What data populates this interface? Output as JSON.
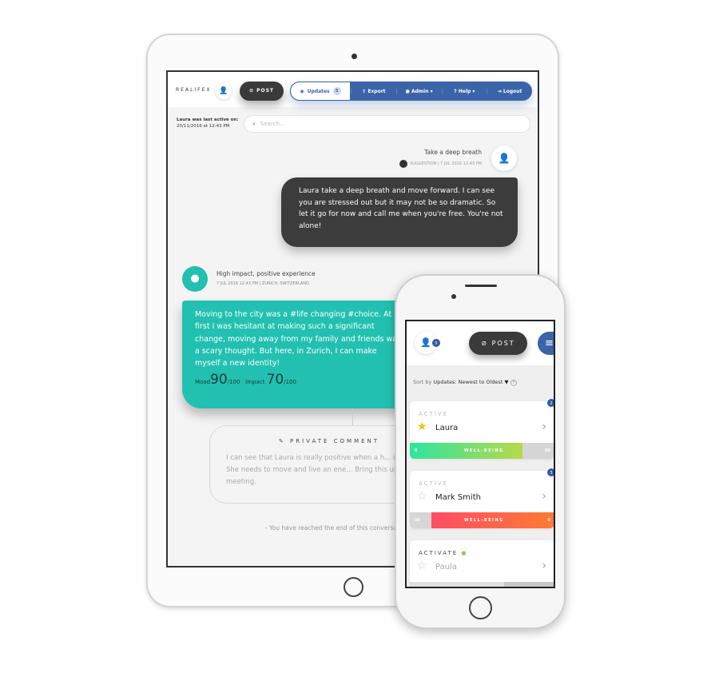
{
  "tablet": {
    "brand": "REALIFEX",
    "post_label": "POST",
    "nav": [
      {
        "label": "Updates",
        "badge": "5"
      },
      {
        "label": "Export"
      },
      {
        "label": "Admin"
      },
      {
        "label": "Help"
      },
      {
        "label": "Logout"
      }
    ],
    "last_active_label": "Laura was last active on:",
    "last_active_date": "20/11/2016 at 12:43 PM",
    "search_placeholder": "Search...",
    "suggestion": {
      "title": "Take a deep breath",
      "meta": "SUGGESTION | 7 JUL 2016 12:43 PM",
      "text": "Laura take a deep breath and move forward. I can see you are stressed out but it may not be so dramatic. So let it go for now and call me when you're free. You're not alone!"
    },
    "experience": {
      "title": "High impact, positive experience",
      "date": "7 JUL 2016 12:43 PM",
      "location": "ZURICH, SWITZERLAND",
      "text": "Moving to the city was a #life changing #choice. At first I was hesitant at making such a significant change, moving away from my family and friends was a scary thought. But here, in Zurich, I can make myself a new identity!",
      "mood_label": "Mood",
      "mood": "90",
      "mood_max": "/100",
      "impact_label": "Impact",
      "impact": "70",
      "impact_max": "/100"
    },
    "comment": {
      "title": "PRIVATE COMMENT",
      "text": "I can see that Laura is really positive when a h... in her life. She needs to move and live an ene... Bring this up during meeting."
    },
    "end_text": "- You have reached the end of this conversation"
  },
  "phone": {
    "avatar_badge": "5",
    "post_label": "POST",
    "sort_prefix": "Sort by",
    "sort_value": "Updates: Newest to Oldest",
    "cards": [
      {
        "status": "ACTIVE",
        "name": "Laura",
        "starred": true,
        "badge": "2",
        "bar_label": "WELL-BEING",
        "bar_min": "0",
        "bar_max": "50",
        "fill": 0.78
      },
      {
        "status": "ACTIVE",
        "name": "Mark Smith",
        "starred": false,
        "badge": "3",
        "bar_label": "WELL-BEING",
        "bar_min": "-50",
        "bar_max": "0",
        "fill": 0.85
      },
      {
        "status": "ACTIVATE",
        "name": "Paula",
        "starred": false
      }
    ]
  },
  "colors": {
    "teal": "#22c0b0",
    "blue": "#3b64a8",
    "dark": "#3a3a3a"
  }
}
